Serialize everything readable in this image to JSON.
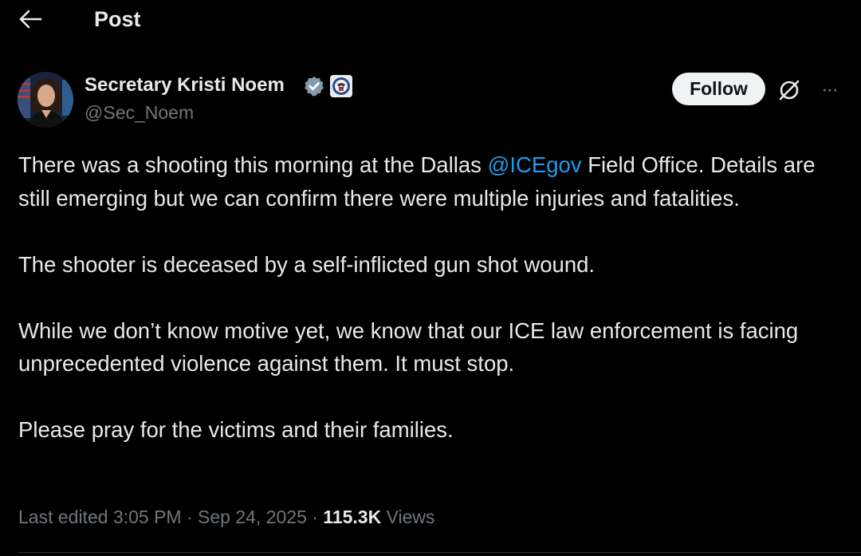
{
  "header": {
    "title": "Post",
    "back_icon": "arrow-left-icon"
  },
  "author": {
    "name": "Secretary Kristi Noem",
    "handle": "@Sec_Noem",
    "verified_icon": "verified-badge-icon",
    "verified_color": "#829aab",
    "affiliation_icon": "dhs-seal-icon"
  },
  "actions": {
    "follow_label": "Follow",
    "grok_icon": "grok-icon",
    "more_icon": "more-horizontal-icon",
    "more_label": "···"
  },
  "post": {
    "para1_before": "There was a shooting this morning at the Dallas ",
    "para1_mention": "@ICEgov",
    "para1_after": " Field Office. Details are still emerging but we can confirm there were multiple injuries and fatalities.",
    "para2": "The shooter is deceased by a self-inflicted gun shot wound.",
    "para3": "While we don’t know motive yet, we know that our ICE law enforcement is facing unprecedented violence against them. It must stop.",
    "para4": "Please pray for the victims and their families."
  },
  "meta": {
    "edited": "Last edited 3:05 PM · Sep 24, 2025 · ",
    "views_count": "115.3K",
    "views_label": " Views"
  },
  "colors": {
    "background": "#000000",
    "text": "#e7e9ea",
    "secondary": "#71767b",
    "link": "#1d9bf0",
    "follow_bg": "#eff3f4",
    "follow_text": "#0f1419",
    "divider": "#2f3336"
  }
}
